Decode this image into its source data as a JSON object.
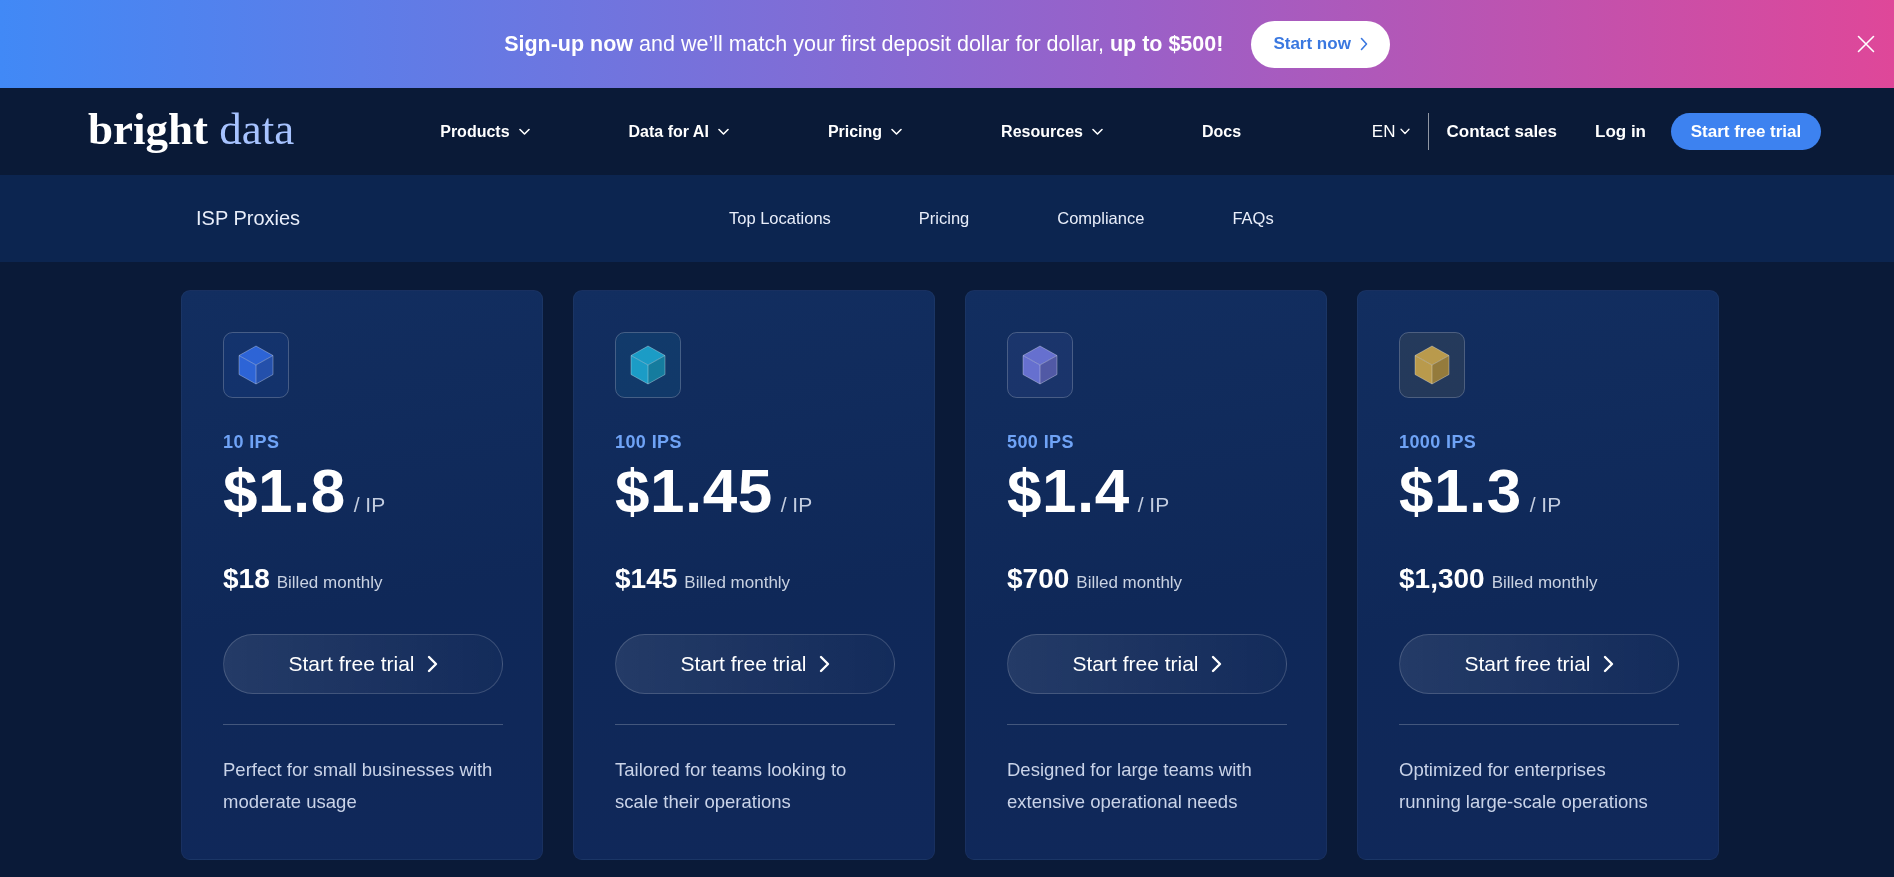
{
  "promo_banner": {
    "text": "**Sign-up now** and we’ll match your first deposit dollar for dollar, **up to $500!**",
    "button": "Start now"
  },
  "header": {
    "logo": [
      "bright",
      "data"
    ],
    "nav": [
      {
        "label": "Products",
        "dropdown": true
      },
      {
        "label": "Data for AI",
        "dropdown": true
      },
      {
        "label": "Pricing",
        "dropdown": true
      },
      {
        "label": "Resources",
        "dropdown": true
      },
      {
        "label": "Docs",
        "dropdown": false
      }
    ],
    "language": "EN",
    "contact": "Contact sales",
    "login": "Log in",
    "cta": "Start free trial"
  },
  "subnav": {
    "title": "ISP Proxies",
    "links": [
      "Top Locations",
      "Pricing",
      "Compliance",
      "FAQs"
    ]
  },
  "plans": [
    {
      "color": "#2d64d6",
      "tier": "10 IPS",
      "price": "$1.8",
      "unit": "/ IP",
      "monthly": "$18",
      "billing": "Billed monthly",
      "button": "Start free trial",
      "description": "Perfect for small businesses with moderate usage"
    },
    {
      "color": "#1b9cc6",
      "tier": "100 IPS",
      "price": "$1.45",
      "unit": "/ IP",
      "monthly": "$145",
      "billing": "Billed monthly",
      "button": "Start free trial",
      "description": "Tailored for teams looking to scale their operations"
    },
    {
      "color": "#6670cf",
      "tier": "500 IPS",
      "price": "$1.4",
      "unit": "/ IP",
      "monthly": "$700",
      "billing": "Billed monthly",
      "button": "Start free trial",
      "description": "Designed for large teams with extensive operational needs"
    },
    {
      "color": "#b99a4c",
      "tier": "1000 IPS",
      "price": "$1.3",
      "unit": "/ IP",
      "monthly": "$1,300",
      "billing": "Billed monthly",
      "button": "Start free trial",
      "description": "Optimized for enterprises running large-scale operations"
    }
  ]
}
